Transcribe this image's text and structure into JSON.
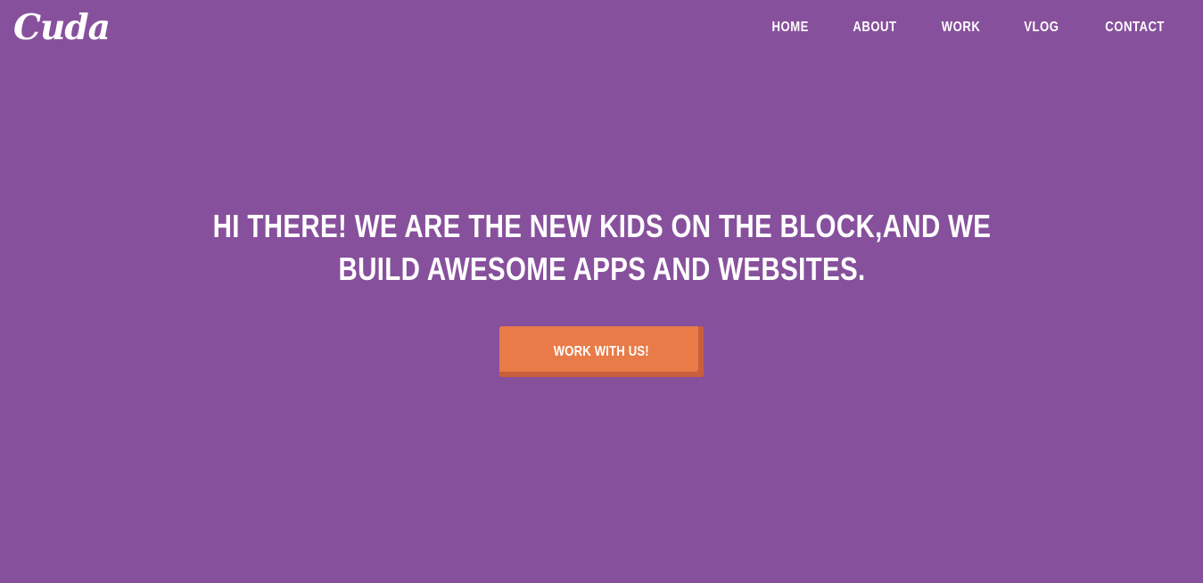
{
  "brand": {
    "logo_text": "Cuda"
  },
  "nav": {
    "items": [
      {
        "label": "HOME"
      },
      {
        "label": "ABOUT"
      },
      {
        "label": "WORK"
      },
      {
        "label": "VLOG"
      },
      {
        "label": "CONTACT"
      }
    ]
  },
  "hero": {
    "headline": "HI THERE! WE ARE THE NEW KIDS ON THE BLOCK,AND WE BUILD AWESOME APPS AND WEBSITES.",
    "cta_label": "WORK WITH US!"
  },
  "colors": {
    "background": "#87509c",
    "accent": "#e97b48",
    "accent_shadow": "#c95f3c",
    "text": "#ffffff"
  }
}
